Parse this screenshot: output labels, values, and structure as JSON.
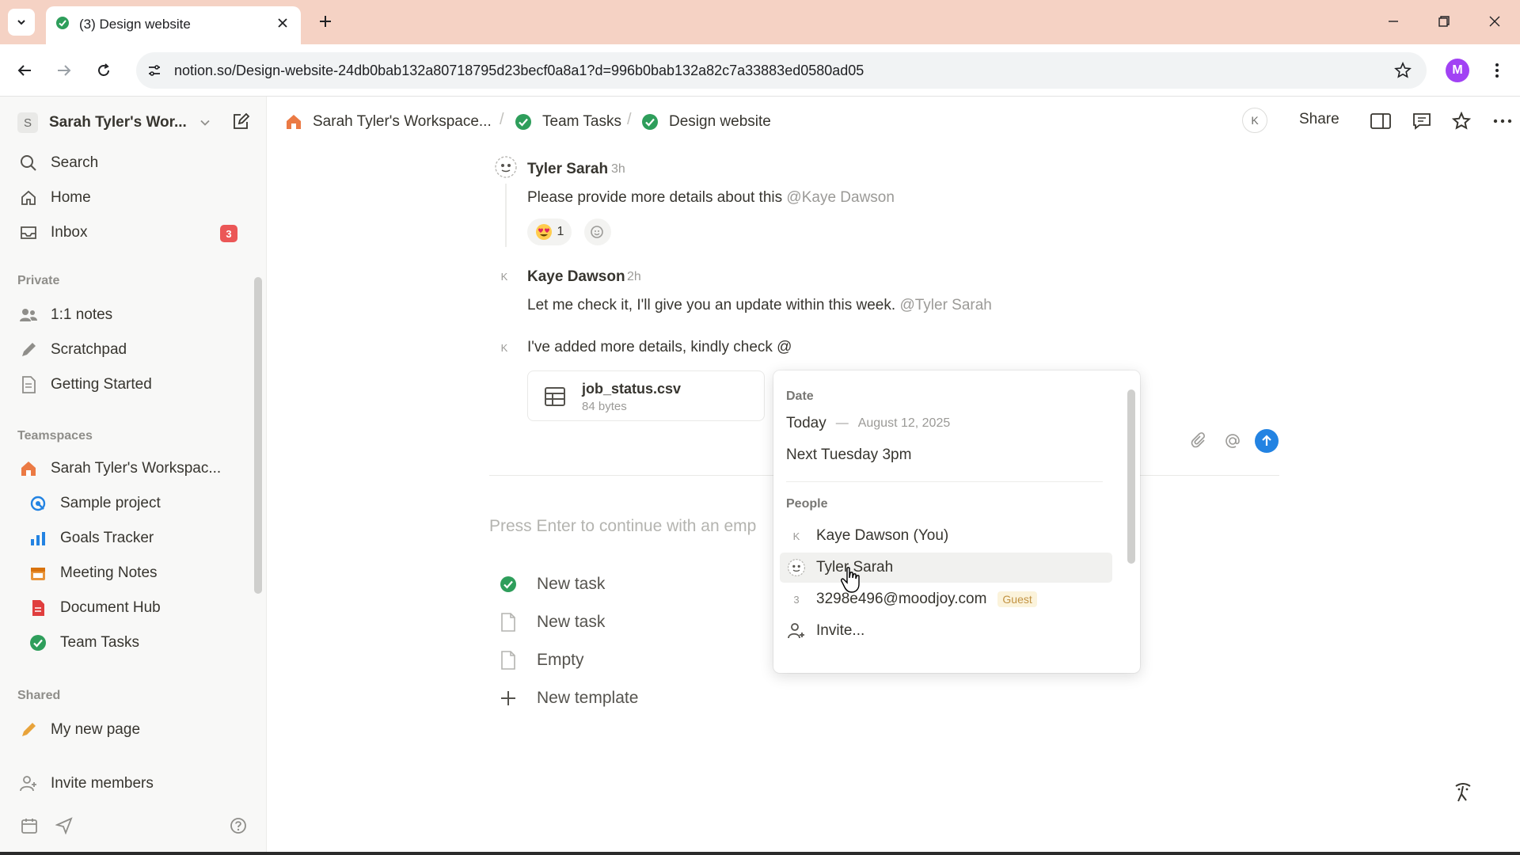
{
  "browser": {
    "tab_title": "(3) Design website",
    "url": "notion.so/Design-website-24db0bab132a80718795d23becf0a8a1?d=996b0bab132a82c7a33883ed0580ad05",
    "profile_initial": "M",
    "colors": {
      "tabbar": "#f5d2c4",
      "profile": "#a142f4"
    }
  },
  "sidebar": {
    "workspace_initial": "S",
    "workspace_name": "Sarah Tyler's Wor...",
    "top_items": [
      {
        "label": "Search",
        "icon": "search-icon"
      },
      {
        "label": "Home",
        "icon": "home-icon"
      },
      {
        "label": "Inbox",
        "icon": "inbox-icon",
        "badge": "3"
      }
    ],
    "private_label": "Private",
    "private_items": [
      {
        "label": "1:1 notes",
        "icon": "people-icon"
      },
      {
        "label": "Scratchpad",
        "icon": "pencil-icon"
      },
      {
        "label": "Getting Started",
        "icon": "page-icon"
      }
    ],
    "teamspaces_label": "Teamspaces",
    "teamspace_name": "Sarah Tyler's Workspac...",
    "teamspace_items": [
      {
        "label": "Sample project",
        "icon": "project-icon"
      },
      {
        "label": "Goals Tracker",
        "icon": "chart-icon"
      },
      {
        "label": "Meeting Notes",
        "icon": "calendar-icon"
      },
      {
        "label": "Document Hub",
        "icon": "document-icon"
      },
      {
        "label": "Team Tasks",
        "icon": "check-circle-icon"
      }
    ],
    "shared_label": "Shared",
    "shared_items": [
      {
        "label": "My new page",
        "icon": "pencil-icon"
      }
    ],
    "invite_label": "Invite members"
  },
  "topbar": {
    "breadcrumbs": [
      "Sarah Tyler's Workspace...",
      "Team Tasks",
      "Design website"
    ],
    "avatar_initial": "K",
    "share_label": "Share"
  },
  "comments": [
    {
      "author": "Tyler Sarah",
      "time": "3h",
      "text": "Please provide more details about this",
      "mention": "@Kaye Dawson",
      "reaction_count": "1"
    },
    {
      "author": "Kaye Dawson",
      "time": "2h",
      "text": "Let me check it, I'll give you an update within this week.",
      "mention": "@Tyler Sarah"
    }
  ],
  "draft": {
    "avatar_initial": "K",
    "text": "I've added more details, kindly check @",
    "attachment_name": "job_status.csv",
    "attachment_size": "84 bytes"
  },
  "placeholder": "Press Enter to continue with an emp",
  "templates": [
    {
      "label": "New task",
      "icon": "check-circle-icon"
    },
    {
      "label": "New task",
      "icon": "page-icon"
    },
    {
      "label": "Empty",
      "icon": "page-icon"
    },
    {
      "label": "New template",
      "icon": "plus-icon"
    }
  ],
  "mention_popup": {
    "date_label": "Date",
    "today_label": "Today",
    "today_date": "August 12, 2025",
    "next_label": "Next Tuesday 3pm",
    "people_label": "People",
    "people": [
      {
        "initial": "K",
        "name": "Kaye Dawson (You)"
      },
      {
        "name": "Tyler Sarah"
      },
      {
        "initial": "3",
        "name": "3298e496@moodjoy.com",
        "badge": "Guest"
      }
    ],
    "invite_label": "Invite..."
  }
}
